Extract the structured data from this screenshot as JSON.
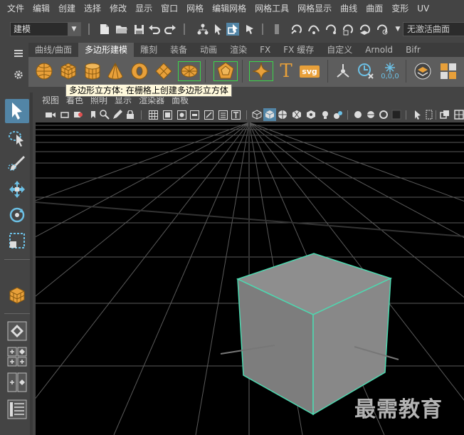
{
  "menubar": {
    "items": [
      "文件",
      "编辑",
      "创建",
      "选择",
      "修改",
      "显示",
      "窗口",
      "网格",
      "编辑网格",
      "网格工具",
      "网格显示",
      "曲线",
      "曲面",
      "变形",
      "UV"
    ]
  },
  "statusline": {
    "mode": "建模",
    "constraint_field": "无激活曲面"
  },
  "shelf": {
    "tabs": [
      "曲线/曲面",
      "多边形建模",
      "雕刻",
      "装备",
      "动画",
      "渲染",
      "FX",
      "FX 缓存",
      "自定义",
      "Arnold",
      "Bifr"
    ],
    "active_tab": "多边形建模",
    "text_tool_glyph": "T",
    "svg_tool_label": "svg",
    "uv_label": "0,0,0"
  },
  "tooltip": {
    "text": "多边形立方体: 在栅格上创建多边形立方体"
  },
  "panel_menu": {
    "items": [
      "视图",
      "着色",
      "照明",
      "显示",
      "渲染器",
      "面板"
    ]
  },
  "watermark": "最需教育",
  "colors": {
    "accent_blue": "#5285a6",
    "shelf_orange": "#e8a03a",
    "cube_face": "#8b8b8b",
    "cube_edge": "#4dd9b0"
  }
}
